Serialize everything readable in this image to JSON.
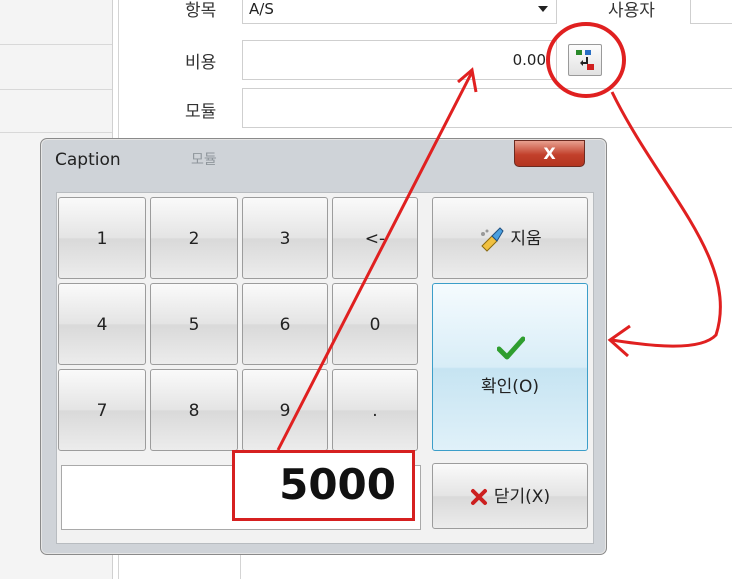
{
  "background_form": {
    "rows": [
      {
        "label": "항목",
        "value": "A/S",
        "extra_label": "사용자"
      },
      {
        "label": "비용",
        "value": "0.00"
      },
      {
        "label": "모듈",
        "value": ""
      }
    ]
  },
  "dialog": {
    "title": "Caption",
    "faded_title": "모듈",
    "close_label": "X",
    "keys": [
      "1",
      "2",
      "3",
      "<-",
      "4",
      "5",
      "6",
      "0",
      "7",
      "8",
      "9",
      "."
    ],
    "clear_label": "지움",
    "confirm_label": "확인(O)",
    "close_button_label": "닫기(X)",
    "amount_value": "5000"
  },
  "colors": {
    "annotation_red": "#e02020",
    "dialog_chrome": "#cfd3d8",
    "confirm_accent": "#3c9ec9",
    "check_green": "#2f9e2f",
    "x_red": "#cc1f1f"
  },
  "icons": {
    "picker": "calculator-picker-icon",
    "eraser": "eraser-icon",
    "check": "checkmark-icon",
    "x": "x-mark-icon"
  }
}
